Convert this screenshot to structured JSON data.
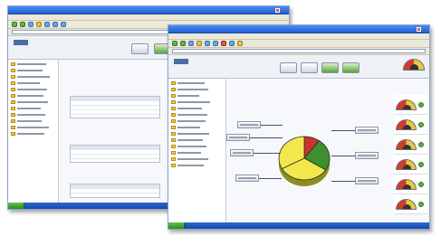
{
  "windows": {
    "back": {
      "title": "",
      "section_title": "",
      "app_title": ""
    },
    "front": {
      "title": "",
      "app_title": ""
    }
  },
  "chart_data": {
    "type": "pie",
    "title": "",
    "subtitle": "",
    "slices": [
      {
        "label": "",
        "value": 10,
        "color": "#c9372c"
      },
      {
        "label": "",
        "value": 24,
        "color": "#3e8f2d"
      },
      {
        "label": "",
        "value": 33,
        "color": "#f2e74d"
      },
      {
        "label": "",
        "value": 33,
        "color": "#f2e74d"
      }
    ]
  },
  "status": {
    "gauges": [
      {
        "name": "gauge-1",
        "status_color": "#5bae3f"
      },
      {
        "name": "gauge-2",
        "status_color": "#5bae3f"
      },
      {
        "name": "gauge-3",
        "status_color": "#5bae3f"
      },
      {
        "name": "gauge-4",
        "status_color": "#5bae3f"
      },
      {
        "name": "gauge-5",
        "status_color": "#5bae3f"
      },
      {
        "name": "gauge-6",
        "status_color": "#5bae3f"
      }
    ]
  }
}
